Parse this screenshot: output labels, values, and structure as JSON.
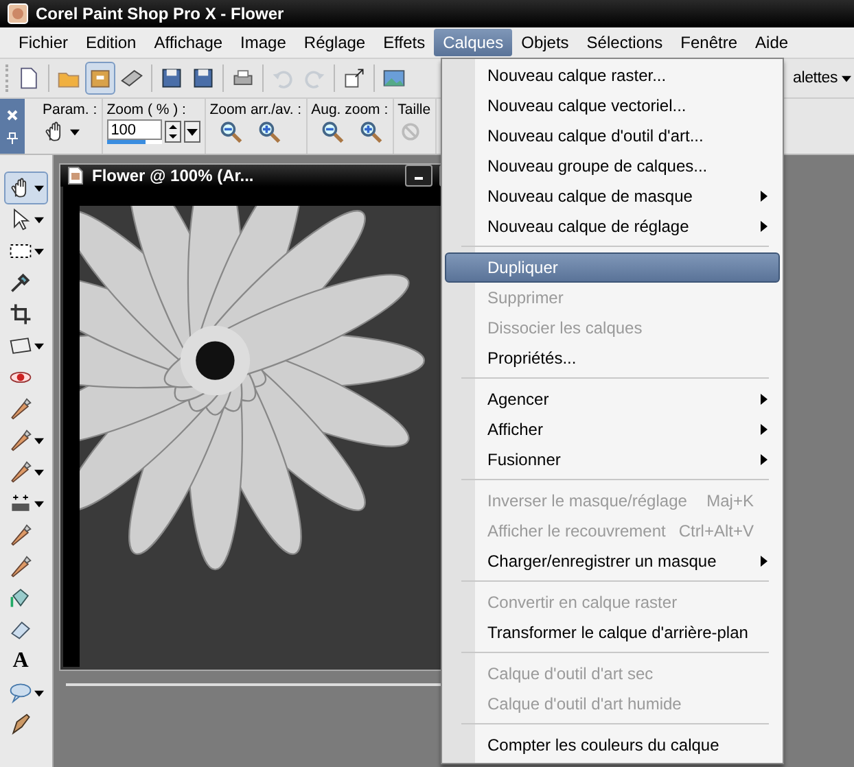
{
  "window": {
    "title": "Corel Paint Shop Pro X - Flower"
  },
  "menu_bar": [
    {
      "label": "Fichier",
      "selected": false
    },
    {
      "label": "Edition",
      "selected": false
    },
    {
      "label": "Affichage",
      "selected": false
    },
    {
      "label": "Image",
      "selected": false
    },
    {
      "label": "Réglage",
      "selected": false
    },
    {
      "label": "Effets",
      "selected": false
    },
    {
      "label": "Calques",
      "selected": true
    },
    {
      "label": "Objets",
      "selected": false
    },
    {
      "label": "Sélections",
      "selected": false
    },
    {
      "label": "Fenêtre",
      "selected": false
    },
    {
      "label": "Aide",
      "selected": false
    }
  ],
  "toolbar": {
    "buttons": [
      {
        "kind": "new",
        "pressed": false,
        "disabled": false
      },
      {
        "kind": "separator"
      },
      {
        "kind": "open",
        "pressed": false,
        "disabled": false
      },
      {
        "kind": "browse",
        "pressed": true,
        "disabled": false
      },
      {
        "kind": "scan",
        "pressed": false,
        "disabled": false
      },
      {
        "kind": "separator"
      },
      {
        "kind": "save",
        "pressed": false,
        "disabled": false
      },
      {
        "kind": "save-as",
        "pressed": false,
        "disabled": false
      },
      {
        "kind": "separator"
      },
      {
        "kind": "print",
        "pressed": false,
        "disabled": false
      },
      {
        "kind": "separator"
      },
      {
        "kind": "undo",
        "pressed": false,
        "disabled": true
      },
      {
        "kind": "redo",
        "pressed": false,
        "disabled": true
      },
      {
        "kind": "separator"
      },
      {
        "kind": "resize",
        "pressed": false,
        "disabled": false
      },
      {
        "kind": "separator"
      },
      {
        "kind": "photo",
        "pressed": false,
        "disabled": false
      }
    ],
    "palettes_label": "alettes"
  },
  "tool_options": {
    "param_label": "Param. :",
    "zoom_label": "Zoom ( % ) :",
    "zoom_value": "100",
    "zoom_slider": {
      "level": 0.7
    },
    "zoom_steps_label": "Zoom arr./av. :",
    "magnify_label": "Aug. zoom :",
    "size_label": "Taille"
  },
  "toolbox": [
    {
      "kind": "pan",
      "dropdown": true,
      "selected": true
    },
    {
      "kind": "pick",
      "dropdown": true,
      "selected": false
    },
    {
      "kind": "selection",
      "dropdown": true,
      "selected": false
    },
    {
      "kind": "dropper",
      "dropdown": false,
      "selected": false
    },
    {
      "kind": "crop",
      "dropdown": false,
      "selected": false
    },
    {
      "kind": "straighten",
      "dropdown": true,
      "selected": false
    },
    {
      "kind": "red-eye",
      "dropdown": false,
      "selected": false
    },
    {
      "kind": "makeover",
      "dropdown": false,
      "selected": false
    },
    {
      "kind": "clone",
      "dropdown": true,
      "selected": false
    },
    {
      "kind": "brush",
      "dropdown": true,
      "selected": false
    },
    {
      "kind": "gradient",
      "dropdown": true,
      "selected": false
    },
    {
      "kind": "lighten",
      "dropdown": false,
      "selected": false
    },
    {
      "kind": "replace",
      "dropdown": false,
      "selected": false
    },
    {
      "kind": "fill",
      "dropdown": false,
      "selected": false
    },
    {
      "kind": "eraser",
      "dropdown": false,
      "selected": false
    },
    {
      "kind": "text",
      "glyph": "A",
      "dropdown": false,
      "selected": false
    },
    {
      "kind": "shape",
      "dropdown": true,
      "selected": false
    },
    {
      "kind": "pen",
      "dropdown": false,
      "selected": false
    }
  ],
  "document": {
    "title": "Flower @ 100% (Ar..."
  },
  "layers_menu": [
    {
      "kind": "item",
      "label": "Nouveau calque raster...",
      "disabled": false,
      "selected": false,
      "submenu": false
    },
    {
      "kind": "item",
      "label": "Nouveau calque vectoriel...",
      "disabled": false,
      "selected": false,
      "submenu": false
    },
    {
      "kind": "item",
      "label": "Nouveau calque d'outil d'art...",
      "disabled": false,
      "selected": false,
      "submenu": false
    },
    {
      "kind": "item",
      "label": "Nouveau groupe de calques...",
      "disabled": false,
      "selected": false,
      "submenu": false
    },
    {
      "kind": "item",
      "label": "Nouveau calque de masque",
      "disabled": false,
      "selected": false,
      "submenu": true
    },
    {
      "kind": "item",
      "label": "Nouveau calque de réglage",
      "disabled": false,
      "selected": false,
      "submenu": true
    },
    {
      "kind": "separator"
    },
    {
      "kind": "item",
      "label": "Dupliquer",
      "disabled": false,
      "selected": true,
      "submenu": false
    },
    {
      "kind": "item",
      "label": "Supprimer",
      "disabled": true,
      "selected": false,
      "submenu": false
    },
    {
      "kind": "item",
      "label": "Dissocier les calques",
      "disabled": true,
      "selected": false,
      "submenu": false
    },
    {
      "kind": "item",
      "label": "Propriétés...",
      "disabled": false,
      "selected": false,
      "submenu": false
    },
    {
      "kind": "separator"
    },
    {
      "kind": "item",
      "label": "Agencer",
      "disabled": false,
      "selected": false,
      "submenu": true
    },
    {
      "kind": "item",
      "label": "Afficher",
      "disabled": false,
      "selected": false,
      "submenu": true
    },
    {
      "kind": "item",
      "label": "Fusionner",
      "disabled": false,
      "selected": false,
      "submenu": true
    },
    {
      "kind": "separator"
    },
    {
      "kind": "item",
      "label": "Inverser le masque/réglage",
      "disabled": true,
      "selected": false,
      "submenu": false,
      "shortcut": "Maj+K"
    },
    {
      "kind": "item",
      "label": "Afficher le recouvrement",
      "disabled": true,
      "selected": false,
      "submenu": false,
      "shortcut": "Ctrl+Alt+V"
    },
    {
      "kind": "item",
      "label": "Charger/enregistrer un masque",
      "disabled": false,
      "selected": false,
      "submenu": true
    },
    {
      "kind": "separator"
    },
    {
      "kind": "item",
      "label": "Convertir en calque raster",
      "disabled": true,
      "selected": false,
      "submenu": false
    },
    {
      "kind": "item",
      "label": "Transformer le calque d'arrière-plan",
      "disabled": false,
      "selected": false,
      "submenu": false
    },
    {
      "kind": "separator"
    },
    {
      "kind": "item",
      "label": "Calque d'outil d'art sec",
      "disabled": true,
      "selected": false,
      "submenu": false
    },
    {
      "kind": "item",
      "label": "Calque d'outil d'art humide",
      "disabled": true,
      "selected": false,
      "submenu": false
    },
    {
      "kind": "separator"
    },
    {
      "kind": "item",
      "label": "Compter les couleurs du calque",
      "disabled": false,
      "selected": false,
      "submenu": false
    }
  ]
}
